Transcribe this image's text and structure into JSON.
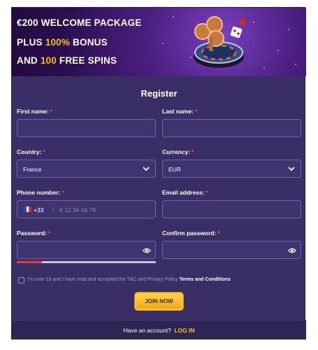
{
  "banner": {
    "line1_amount": "€200",
    "line1_rest": " WELCOME PACKAGE",
    "line2_pre": "PLUS ",
    "line2_hl": "100%",
    "line2_post": " BONUS",
    "line3_pre": "AND ",
    "line3_hl": "100",
    "line3_post": " FREE SPINS"
  },
  "form": {
    "title": "Register",
    "first_name_label": "First name:",
    "last_name_label": "Last name:",
    "country_label": "Country:",
    "country_value": "France",
    "currency_label": "Currency:",
    "currency_value": "EUR",
    "phone_label": "Phone number:",
    "phone_code": "+33",
    "phone_separator": "•",
    "phone_placeholder": "6 12 34 56 78",
    "email_label": "Email address:",
    "password_label": "Password:",
    "confirm_password_label": "Confirm password:",
    "required_mark": "*",
    "password_strength": 0.18,
    "terms_text": "I'm over 18 and I have read and accepted the T&C and Privacy Policy ",
    "terms_link": "Terms and Conditions",
    "join_label": "JOIN NOW"
  },
  "footer": {
    "question": "Have an account?",
    "login_link": "LOG IN"
  },
  "colors": {
    "accent_gold": "#f5c218",
    "modal_bg": "#3a2e66",
    "field_bg": "#3f3470",
    "strength_bar": "#e04040"
  },
  "icons": [
    "chevron-down-icon",
    "eye-icon",
    "france-flag-icon",
    "casino-chips-icon"
  ]
}
